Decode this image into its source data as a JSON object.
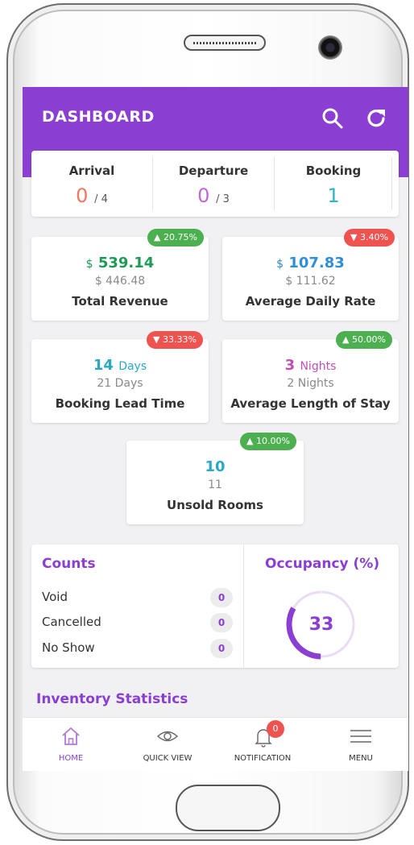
{
  "header": {
    "title": "DASHBOARD"
  },
  "summary": {
    "arrival": {
      "label": "Arrival",
      "value": "0",
      "total": "/ 4"
    },
    "departure": {
      "label": "Departure",
      "value": "0",
      "total": "/ 3"
    },
    "booking": {
      "label": "Booking",
      "value": "1"
    }
  },
  "metrics": {
    "total_revenue": {
      "currency": "$",
      "value": "539.14",
      "previous": "$ 446.48",
      "label": "Total Revenue",
      "change": "20.75%",
      "trend": "up"
    },
    "adr": {
      "currency": "$",
      "value": "107.83",
      "previous": "$ 111.62",
      "label": "Average Daily Rate",
      "change": "3.40%",
      "trend": "down"
    },
    "lead_time": {
      "value": "14",
      "unit": "Days",
      "previous": "21 Days",
      "label": "Booking Lead Time",
      "change": "33.33%",
      "trend": "down"
    },
    "length_of_stay": {
      "value": "3",
      "unit": "Nights",
      "previous": "2 Nights",
      "label": "Average Length of Stay",
      "change": "50.00%",
      "trend": "up"
    },
    "unsold_rooms": {
      "value": "10",
      "previous": "11",
      "label": "Unsold Rooms",
      "change": "10.00%",
      "trend": "up"
    }
  },
  "counts": {
    "title": "Counts",
    "rows": [
      {
        "label": "Void",
        "count": "0"
      },
      {
        "label": "Cancelled",
        "count": "0"
      },
      {
        "label": "No Show",
        "count": "0"
      }
    ]
  },
  "occupancy": {
    "title": "Occupancy (%)",
    "value": "33",
    "percent": 33
  },
  "inventory": {
    "title": "Inventory Statistics"
  },
  "nav": {
    "home": "HOME",
    "quick_view": "QUICK VIEW",
    "notification": "NOTIFICATION",
    "notification_count": "0",
    "menu": "MENU"
  },
  "colors": {
    "primary": "#8a3fd2",
    "up": "#4caf50",
    "down": "#ef5350",
    "arrival": "#f0765f",
    "departure": "#c066d8",
    "booking": "#2fb5c9",
    "revenue": "#1f9a57",
    "adr": "#2f8ed6",
    "lead": "#2aa9c4",
    "stay": "#c24fb6"
  },
  "icons": [
    "search-icon",
    "refresh-icon",
    "home-icon",
    "eye-icon",
    "bell-icon",
    "menu-icon"
  ]
}
